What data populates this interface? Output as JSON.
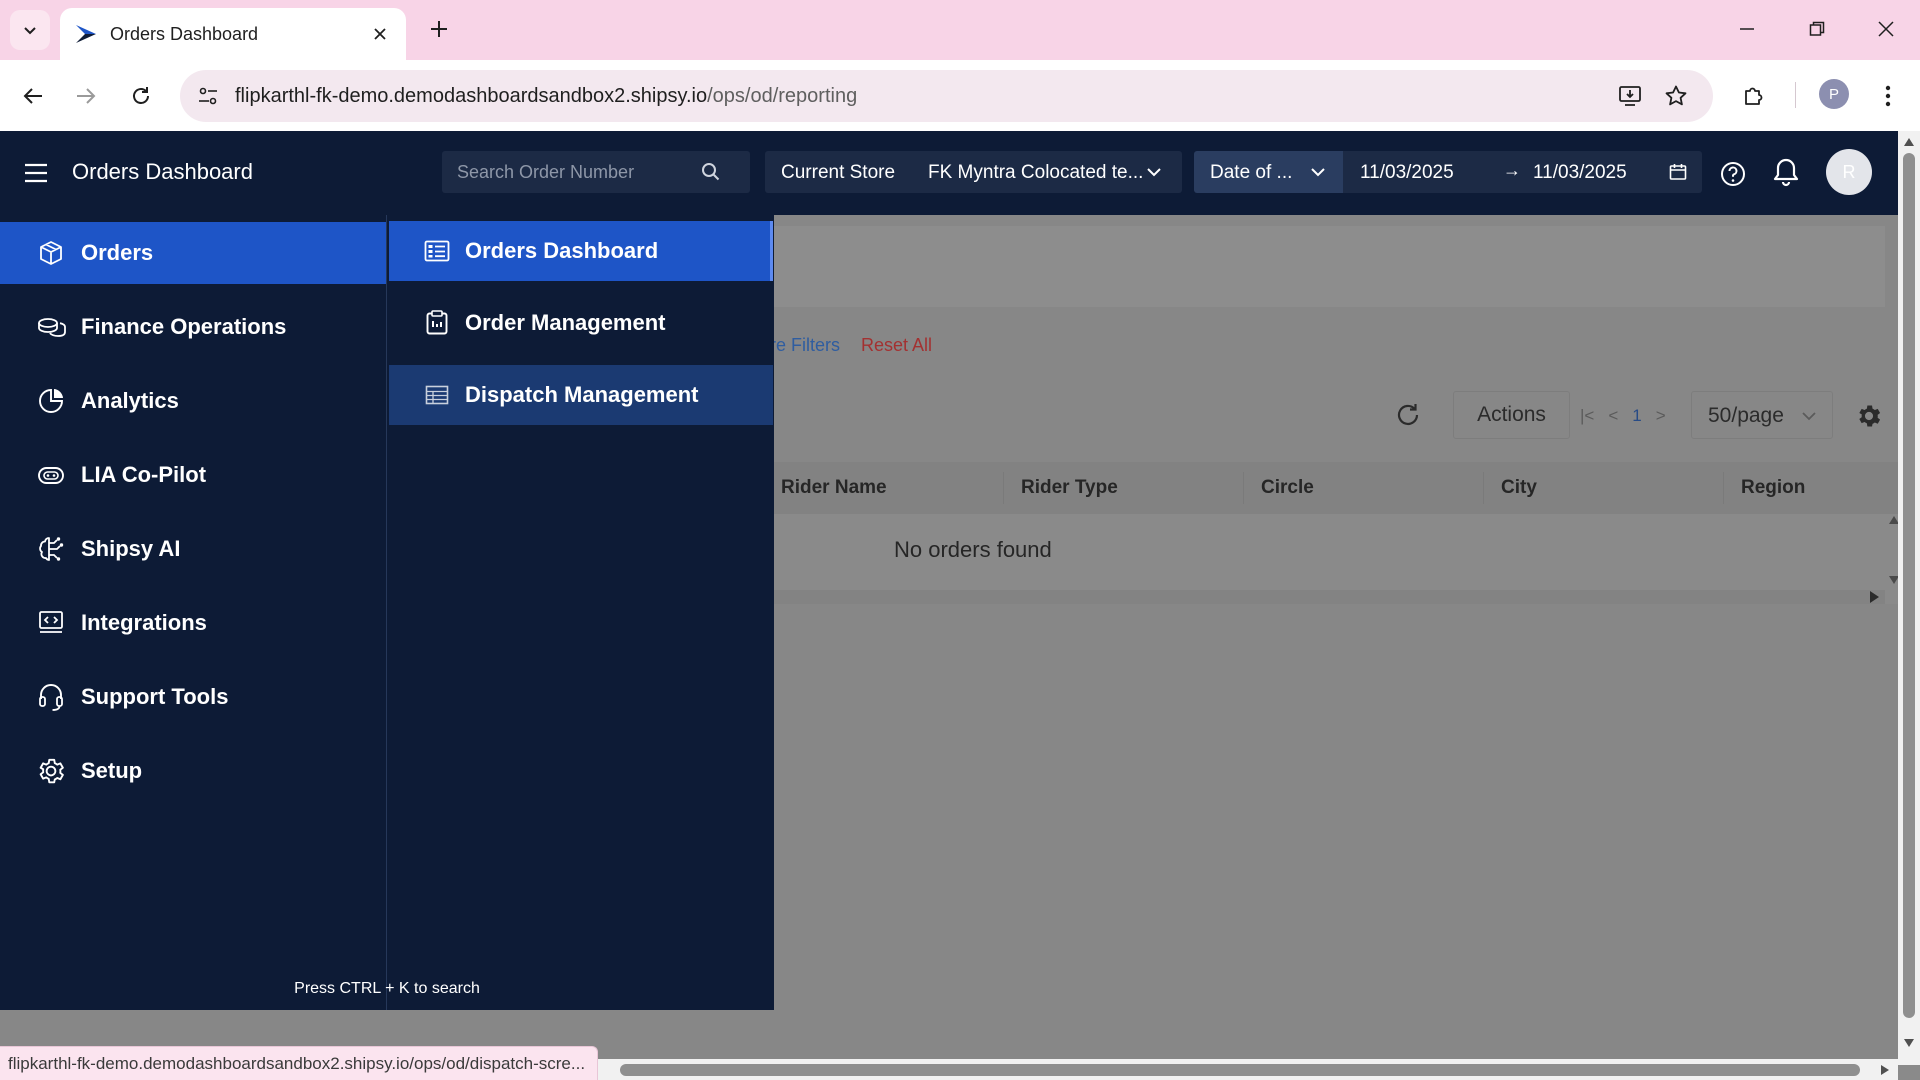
{
  "browser": {
    "tab_title": "Orders Dashboard",
    "url_host": "flipkarthl-fk-demo.demodashboardsandbox2.shipsy.io",
    "url_path": "/ops/od/reporting",
    "profile_initial": "P",
    "status_url": "flipkarthl-fk-demo.demodashboardsandbox2.shipsy.io/ops/od/dispatch-scre..."
  },
  "header": {
    "title": "Orders Dashboard",
    "search_placeholder": "Search Order Number",
    "store_label": "Current Store",
    "store_value": "FK Myntra Colocated te...",
    "date_type": "Date of ...",
    "date_start": "11/03/2025",
    "date_separator": "→",
    "date_end": "11/03/2025",
    "avatar_initial": "R"
  },
  "sidebar": {
    "items": [
      {
        "label": "Orders",
        "icon": "box-icon",
        "active": true
      },
      {
        "label": "Finance Operations",
        "icon": "coins-icon",
        "active": false
      },
      {
        "label": "Analytics",
        "icon": "pie-chart-icon",
        "active": false
      },
      {
        "label": "LIA Co-Pilot",
        "icon": "copilot-icon",
        "active": false
      },
      {
        "label": "Shipsy AI",
        "icon": "brain-icon",
        "active": false
      },
      {
        "label": "Integrations",
        "icon": "monitor-code-icon",
        "active": false
      },
      {
        "label": "Support Tools",
        "icon": "headset-icon",
        "active": false
      },
      {
        "label": "Setup",
        "icon": "gear-icon",
        "active": false
      }
    ],
    "submenu": [
      {
        "label": "Orders Dashboard",
        "icon": "list-icon",
        "state": "active"
      },
      {
        "label": "Order Management",
        "icon": "clipboard-icon",
        "state": "normal"
      },
      {
        "label": "Dispatch Management",
        "icon": "table-icon",
        "state": "hover"
      }
    ],
    "search_hint": "Press CTRL + K to search"
  },
  "content": {
    "more_filters": "re Filters",
    "reset_all": "Reset All",
    "actions_label": "Actions",
    "current_page": "1",
    "page_size": "50/page",
    "columns": [
      "Rider Name",
      "Rider Type",
      "Circle",
      "City",
      "Region"
    ],
    "empty_message": "No orders found"
  },
  "colors": {
    "nav_bg": "#0d1b36",
    "active_blue": "#1e55c7",
    "hover_blue": "#1b3a72",
    "tab_strip": "#f8d4e7"
  }
}
